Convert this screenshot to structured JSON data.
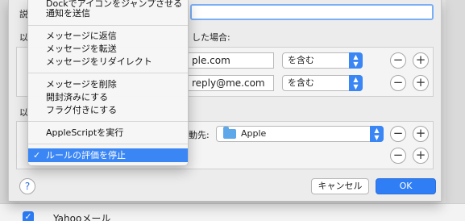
{
  "background": {
    "account_label": "Yahooメール"
  },
  "sheet": {
    "frag_description": "説",
    "frag_conditions_prefix": "以",
    "conditions_header_tail": "した場合:",
    "frag_actions_prefix": "以",
    "conditions": [
      {
        "value": "ple.com",
        "operator": "を含む"
      },
      {
        "value": "reply@me.com",
        "operator": "を含む"
      }
    ],
    "action": {
      "destination_label_tail": "動先:",
      "destination_value": "Apple"
    },
    "help_label": "?",
    "cancel_label": "キャンセル",
    "ok_label": "OK",
    "minus_symbol": "−",
    "plus_symbol": "+"
  },
  "menu": {
    "items": [
      {
        "label": "Dockでアイコンをジャンプさせる",
        "selected": false
      },
      {
        "label": "通知を送信",
        "selected": false
      },
      {
        "label": "メッセージに返信",
        "selected": false
      },
      {
        "label": "メッセージを転送",
        "selected": false
      },
      {
        "label": "メッセージをリダイレクト",
        "selected": false
      },
      {
        "label": "メッセージを削除",
        "selected": false
      },
      {
        "label": "開封済みにする",
        "selected": false
      },
      {
        "label": "フラグ付きにする",
        "selected": false
      },
      {
        "label": "AppleScriptを実行",
        "selected": false
      },
      {
        "label": "ルールの評価を停止",
        "selected": true
      }
    ],
    "check_mark": "✓"
  },
  "colors": {
    "accent": "#3b86f5",
    "ok_button": "#2f7ef6",
    "folder": "#5ea7e8"
  }
}
